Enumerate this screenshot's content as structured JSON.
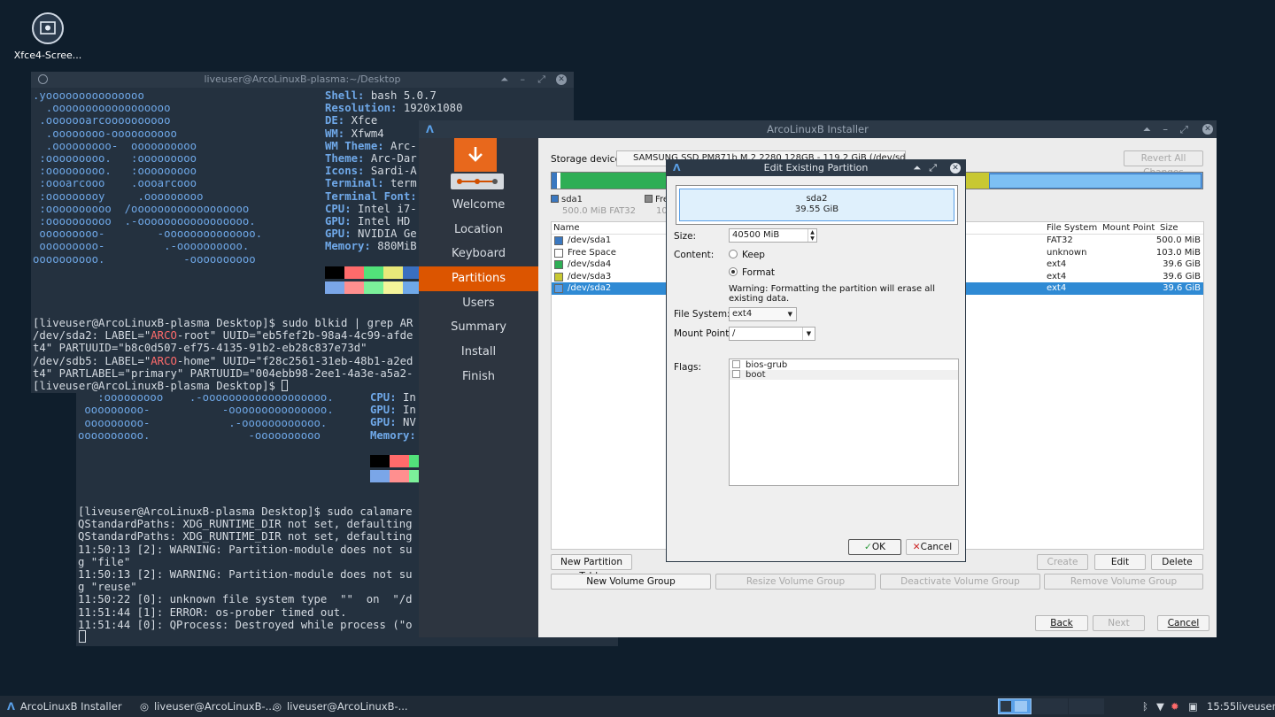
{
  "desktop": {
    "icon_label": "Xfce4-Scree..."
  },
  "term1": {
    "title": "liveuser@ArcoLinuxB-plasma:~/Desktop",
    "art": [
      ".yooooooooooooooo",
      "  .oooooooooooooooooo",
      " .ooooooarcoooooooooo",
      "  .oooooooo-oooooooooo",
      "  .ooooooooo-  oooooooooo",
      " :ooooooooo.   :ooooooooo",
      " :ooooooooo.   :ooooooooo",
      " :oooarcooo    .oooarcooo",
      " :ooooooooy     .ooooooooo",
      " :oooooooooo  /oooooooooooooooooo",
      " :oooooooooo  .-ooooooooooooooooo.",
      " ooooooooo-        -oooooooooooooo.",
      " ooooooooo-         .-oooooooooo.",
      "oooooooooo.            -oooooooooo"
    ],
    "info": [
      [
        "Shell: ",
        "bash 5.0.7"
      ],
      [
        "Resolution: ",
        "1920x1080"
      ],
      [
        "DE: ",
        "Xfce"
      ],
      [
        "WM: ",
        "Xfwm4"
      ],
      [
        "WM Theme: ",
        "Arc-"
      ],
      [
        "Theme: ",
        "Arc-Dar"
      ],
      [
        "Icons: ",
        "Sardi-A"
      ],
      [
        "Terminal: ",
        "term"
      ],
      [
        "Terminal Font: ",
        ""
      ],
      [
        "CPU: ",
        "Intel i7-"
      ],
      [
        "GPU: ",
        "Intel HD"
      ],
      [
        "GPU: ",
        "NVIDIA Ge"
      ],
      [
        "Memory: ",
        "880MiB"
      ]
    ],
    "cmd_line": "[liveuser@ArcoLinuxB-plasma Desktop]$ sudo blkid | grep AR",
    "l1a": "/dev/sda2: LABEL=\"",
    "l1b": "ARCO",
    "l1c": "-root\" UUID=\"eb5fef2b-98a4-4c99-afde",
    "l2": "t4\" PARTUUID=\"b8c0d507-ef75-4135-91b2-eb28c837e73d\"",
    "l3a": "/dev/sdb5: LABEL=\"",
    "l3b": "ARCO",
    "l3c": "-home\" UUID=\"f28c2561-31eb-48b1-a2ed",
    "l4": "t4\" PARTLABEL=\"primary\" PARTUUID=\"004ebb98-2ee1-4a3e-a5a2-",
    "prompt": "[liveuser@ArcoLinuxB-plasma Desktop]$ "
  },
  "term2": {
    "art": [
      "   :ooooooooo     /ooooooooooooooooooo",
      "   :ooooooooo    .-ooooooooooooooooooo.",
      " ooooooooo-           -ooooooooooooooo.",
      " ooooooooo-            .-oooooooooooo.",
      "oooooooooo.               -oooooooooo"
    ],
    "info": [
      [
        "CPU: ",
        "In"
      ],
      [
        "GPU: ",
        "In"
      ],
      [
        "GPU: ",
        "NV"
      ],
      [
        "Memory: ",
        ""
      ]
    ],
    "lines": [
      "[liveuser@ArcoLinuxB-plasma Desktop]$ sudo calamare",
      "QStandardPaths: XDG_RUNTIME_DIR not set, defaulting",
      "QStandardPaths: XDG_RUNTIME_DIR not set, defaulting",
      "11:50:13 [2]: WARNING: Partition-module does not su",
      "g \"file\"",
      "11:50:13 [2]: WARNING: Partition-module does not su",
      "g \"reuse\"",
      "11:50:22 [0]: unknown file system type  \"\"  on  \"/d",
      "11:51:44 [1]: ERROR: os-prober timed out.",
      "11:51:44 [0]: QProcess: Destroyed while process (\"o"
    ]
  },
  "installer": {
    "title": "ArcoLinuxB Installer",
    "steps": [
      "Welcome",
      "Location",
      "Keyboard",
      "Partitions",
      "Users",
      "Summary",
      "Install",
      "Finish"
    ],
    "storage_label": "Storage device:",
    "storage_value": "SAMSUNG SSD PM871b M.2 2280 128GB - 119.2 GiB (/dev/sda)",
    "revert": "Revert All Changes",
    "legend": [
      {
        "name": "sda1",
        "sub": "500.0 MiB  FAT32",
        "color": "#3a78c0"
      },
      {
        "name": "Fre",
        "sub": "10",
        "color": "#888888"
      }
    ],
    "cols": {
      "name": "Name",
      "fs": "File System",
      "mount": "Mount Point",
      "size": "Size"
    },
    "rows": [
      {
        "name": "/dev/sda1",
        "fs": "FAT32",
        "size": "500.0 MiB",
        "color": "#3a78c0"
      },
      {
        "name": "Free Space",
        "fs": "unknown",
        "size": "103.0 MiB",
        "color": "#ffffff"
      },
      {
        "name": "/dev/sda4",
        "fs": "ext4",
        "size": "39.6 GiB",
        "color": "#2eae55"
      },
      {
        "name": "/dev/sda3",
        "fs": "ext4",
        "size": "39.6 GiB",
        "color": "#c8c832"
      },
      {
        "name": "/dev/sda2",
        "fs": "ext4",
        "size": "39.6 GiB",
        "color": "#5aa0e8"
      }
    ],
    "new_table": "New Partition Table",
    "create": "Create",
    "edit": "Edit",
    "delete": "Delete",
    "new_vg": "New Volume Group",
    "resize_vg": "Resize Volume Group",
    "deact_vg": "Deactivate Volume Group",
    "remove_vg": "Remove Volume Group",
    "back": "Back",
    "next": "Next",
    "cancel": "Cancel"
  },
  "dialog": {
    "title": "Edit Existing Partition",
    "part_name": "sda2",
    "part_size": "39.55 GiB",
    "size_label": "Size:",
    "size_value": "40500 MiB",
    "content_label": "Content:",
    "keep": "Keep",
    "format": "Format",
    "warning": "Warning: Formatting the partition will erase all existing data.",
    "fs_label": "File System:",
    "fs_value": "ext4",
    "mount_label": "Mount Point:",
    "mount_value": "/",
    "flags_label": "Flags:",
    "flags": [
      "bios-grub",
      "boot"
    ],
    "ok": "OK",
    "cancel": "Cancel"
  },
  "taskbar": {
    "items": [
      "ArcoLinuxB Installer",
      "liveuser@ArcoLinuxB-...",
      "liveuser@ArcoLinuxB-..."
    ],
    "clock": "15:55",
    "user": "liveuser"
  }
}
